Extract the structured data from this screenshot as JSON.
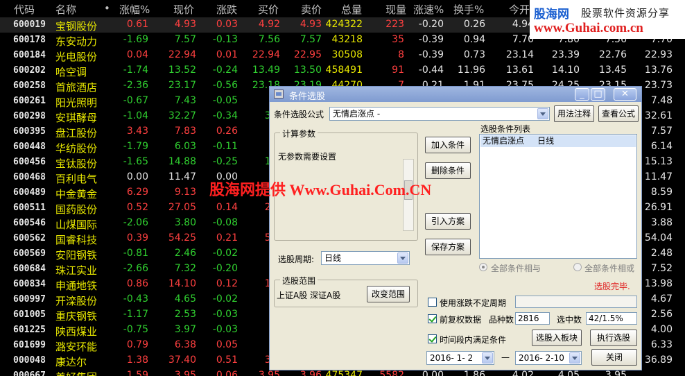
{
  "grid": {
    "headers": [
      "代码",
      "名称",
      "•",
      "涨幅%",
      "现价",
      "涨跌",
      "买价",
      "卖价",
      "总量",
      "现量",
      "涨速%",
      "换手%",
      "今开"
    ],
    "rows": [
      {
        "code": "600019",
        "name": "宝钢股份",
        "v": [
          "0.61",
          "4.93",
          "0.03",
          "4.92",
          "4.93",
          "424322",
          "223",
          "-0.20",
          "0.26",
          "4.94",
          "",
          "",
          ""
        ]
      },
      {
        "code": "600178",
        "name": "东安动力",
        "v": [
          "-1.69",
          "7.57",
          "-0.13",
          "7.56",
          "7.57",
          "43218",
          "35",
          "-0.39",
          "0.94",
          "7.70",
          "7.80",
          "7.56",
          "7.70"
        ]
      },
      {
        "code": "600184",
        "name": "光电股份",
        "v": [
          "0.04",
          "22.94",
          "0.01",
          "22.94",
          "22.95",
          "30508",
          "8",
          "-0.39",
          "0.73",
          "23.14",
          "23.39",
          "22.76",
          "22.93"
        ]
      },
      {
        "code": "600202",
        "name": "哈空调",
        "v": [
          "-1.74",
          "13.52",
          "-0.24",
          "13.49",
          "13.50",
          "458491",
          "91",
          "-0.44",
          "11.96",
          "13.61",
          "14.10",
          "13.45",
          "13.76"
        ]
      },
      {
        "code": "600258",
        "name": "首旅酒店",
        "v": [
          "-2.36",
          "23.17",
          "-0.56",
          "23.18",
          "23.19",
          "44270",
          "7",
          "0.21",
          "1.91",
          "23.75",
          "24.25",
          "23.15",
          "23.73"
        ]
      },
      {
        "code": "600261",
        "name": "阳光照明",
        "v": [
          "-0.67",
          "7.43",
          "-0.05",
          "7.",
          "",
          "",
          "",
          "",
          "",
          "",
          "",
          "",
          "7.48"
        ]
      },
      {
        "code": "600298",
        "name": "安琪酵母",
        "v": [
          "-1.04",
          "32.27",
          "-0.34",
          "32.",
          "",
          "",
          "",
          "",
          "",
          "",
          "",
          "",
          "32.61"
        ]
      },
      {
        "code": "600395",
        "name": "盘江股份",
        "v": [
          "3.43",
          "7.83",
          "0.26",
          "7.",
          "",
          "",
          "",
          "",
          "",
          "",
          "",
          "",
          "7.57"
        ]
      },
      {
        "code": "600448",
        "name": "华纺股份",
        "v": [
          "-1.79",
          "6.03",
          "-0.11",
          "6.",
          "",
          "",
          "",
          "",
          "",
          "",
          "",
          "",
          "6.14"
        ]
      },
      {
        "code": "600456",
        "name": "宝钛股份",
        "v": [
          "-1.65",
          "14.88",
          "-0.25",
          "14.",
          "",
          "",
          "",
          "",
          "",
          "",
          "",
          "",
          "15.13"
        ]
      },
      {
        "code": "600468",
        "name": "百利电气",
        "v": [
          "0.00",
          "11.47",
          "0.00",
          "",
          "",
          "",
          "",
          "",
          "",
          "",
          "",
          "",
          "11.47"
        ]
      },
      {
        "code": "600489",
        "name": "中金黄金",
        "v": [
          "6.29",
          "9.13",
          "",
          "",
          "",
          "",
          "",
          "",
          "",
          "",
          "",
          "",
          "8.59"
        ]
      },
      {
        "code": "600511",
        "name": "国药股份",
        "v": [
          "0.52",
          "27.05",
          "0.14",
          "27.",
          "",
          "",
          "",
          "",
          "",
          "",
          "",
          "",
          "26.91"
        ]
      },
      {
        "code": "600546",
        "name": "山煤国际",
        "v": [
          "-2.06",
          "3.80",
          "-0.08",
          "3.",
          "",
          "",
          "",
          "",
          "",
          "",
          "",
          "",
          "3.88"
        ]
      },
      {
        "code": "600562",
        "name": "国睿科技",
        "v": [
          "0.39",
          "54.25",
          "0.21",
          "54.",
          "",
          "",
          "",
          "",
          "",
          "",
          "",
          "",
          "54.04"
        ]
      },
      {
        "code": "600569",
        "name": "安阳钢铁",
        "v": [
          "-0.81",
          "2.46",
          "-0.02",
          "2.",
          "",
          "",
          "",
          "",
          "",
          "",
          "",
          "",
          "2.48"
        ]
      },
      {
        "code": "600684",
        "name": "珠江实业",
        "v": [
          "-2.66",
          "7.32",
          "-0.20",
          "7.",
          "",
          "",
          "",
          "",
          "",
          "",
          "",
          "",
          "7.52"
        ]
      },
      {
        "code": "600834",
        "name": "申通地铁",
        "v": [
          "0.86",
          "14.10",
          "0.12",
          "14.",
          "",
          "",
          "",
          "",
          "",
          "",
          "",
          "",
          "13.98"
        ]
      },
      {
        "code": "600997",
        "name": "开滦股份",
        "v": [
          "-0.43",
          "4.65",
          "-0.02",
          "4.",
          "",
          "",
          "",
          "",
          "",
          "",
          "",
          "",
          "4.67"
        ]
      },
      {
        "code": "601005",
        "name": "重庆钢铁",
        "v": [
          "-1.17",
          "2.53",
          "-0.03",
          "2.",
          "",
          "",
          "",
          "",
          "",
          "",
          "",
          "",
          "2.56"
        ]
      },
      {
        "code": "601225",
        "name": "陕西煤业",
        "v": [
          "-0.75",
          "3.97",
          "-0.03",
          "3.",
          "",
          "",
          "",
          "",
          "",
          "",
          "",
          "",
          "4.00"
        ]
      },
      {
        "code": "601699",
        "name": "潞安环能",
        "v": [
          "0.79",
          "6.38",
          "0.05",
          "6.",
          "",
          "",
          "",
          "",
          "",
          "",
          "",
          "",
          "6.33"
        ]
      },
      {
        "code": "000048",
        "name": "康达尔",
        "v": [
          "1.38",
          "37.40",
          "0.51",
          "37.",
          "",
          "",
          "",
          "",
          "",
          "",
          "",
          "",
          "36.89"
        ]
      },
      {
        "code": "000667",
        "name": "美好集团",
        "v": [
          "1.59",
          "3.95",
          "0.06",
          "3.95",
          "3.96",
          "475347",
          "5582",
          "0.00",
          "1.86",
          "4.02",
          "4.05",
          "3.95",
          ""
        ]
      }
    ]
  },
  "watermark": {
    "top_brand": "股海网",
    "top_slogan": "股票软件资源分享",
    "top_url": "www.Guhai.com.cn",
    "mid": "股海网提供 Www.Guhai.Com.CN"
  },
  "dialog": {
    "title": "条件选股",
    "formula_label": "条件选股公式",
    "formula_value": "无情启涨点   -",
    "usage_button": "用法注释",
    "view_formula_button": "查看公式",
    "calc_params_title": "计算参数",
    "calc_params_text": "无参数需要设置",
    "period_label": "选股周期:",
    "period_value": "日线",
    "range_title": "选股范围",
    "range_text": "上证A股 深证A股",
    "change_range_button": "改变范围",
    "add_condition_button": "加入条件",
    "delete_condition_button": "删除条件",
    "import_plan_button": "引入方案",
    "save_plan_button": "保存方案",
    "condition_list_label": "选股条件列表",
    "condition_items": [
      "无情启涨点     日线"
    ],
    "radio_and": "全部条件相与",
    "radio_or": "全部条件相或",
    "status": "选股完毕.",
    "use_undefined_period": "使用涨跌不定周期",
    "pre_adjust": "前复权数据",
    "count_label": "品种数",
    "count_value": "2816",
    "selected_label": "选中数",
    "selected_value": "42/1.5%",
    "time_condition": "时间段内满足条件",
    "to_block_button": "选股入板块",
    "execute_button": "执行选股",
    "date_from": "2016- 1- 2",
    "date_sep": "—",
    "date_to": "2016- 2-10",
    "close_button": "关闭"
  },
  "colors": {
    "up": "#ff4040",
    "down": "#30d030",
    "name": "#e6e600"
  }
}
